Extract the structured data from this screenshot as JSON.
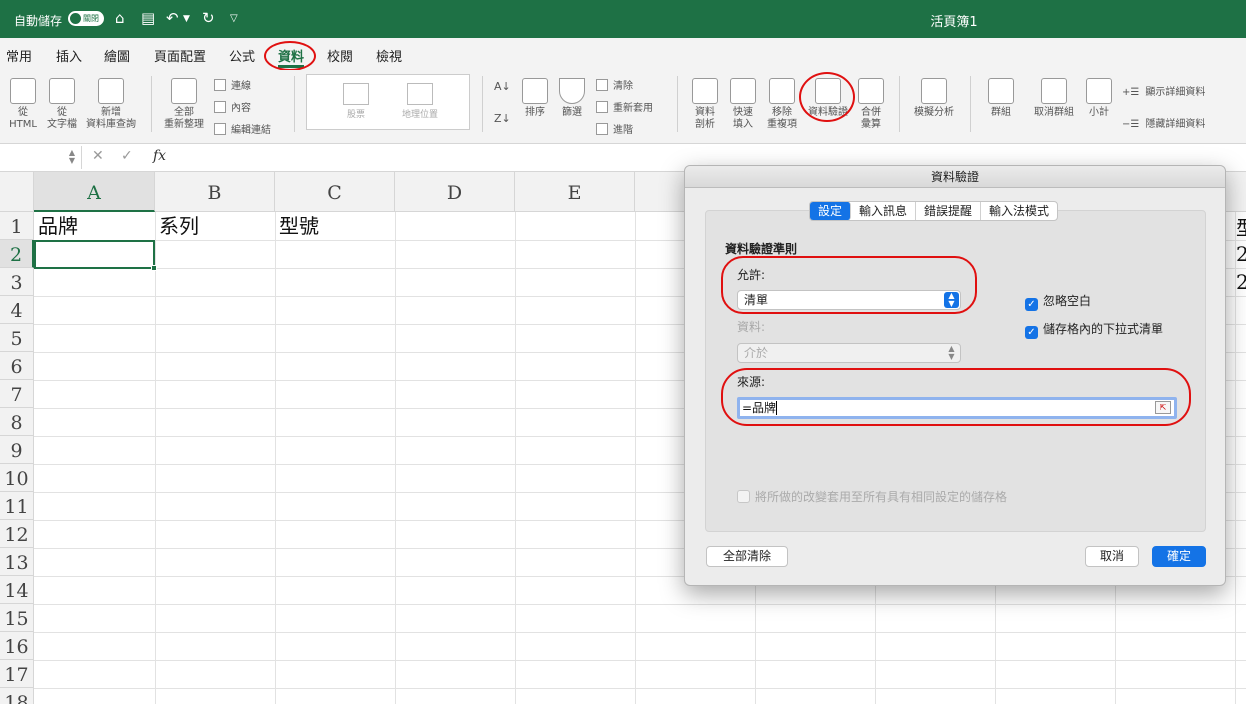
{
  "titlebar": {
    "autosave_label": "自動儲存",
    "autosave_state": "關閉",
    "doc_title": "活頁簿1",
    "icons": [
      "home-icon",
      "save-icon",
      "undo-icon",
      "redo-icon",
      "customize-icon"
    ]
  },
  "tabs": [
    "常用",
    "插入",
    "繪圖",
    "頁面配置",
    "公式",
    "資料",
    "校閱",
    "檢視"
  ],
  "active_tab": "資料",
  "ribbon": {
    "from_html": "從\nHTML",
    "from_text": "從\n文字檔",
    "new_query": "新增\n資料庫查詢",
    "refresh_all": "全部\n重新整理",
    "connections": "連線",
    "properties": "內容",
    "edit_links": "編輯連結",
    "stocks": "股票",
    "geography": "地理位置",
    "sort": "排序",
    "filter": "篩選",
    "clear": "清除",
    "reapply": "重新套用",
    "advanced": "進階",
    "text_to_columns": "資料\n剖析",
    "flash_fill": "快速\n填入",
    "remove_duplicates": "移除\n重複項",
    "data_validation": "資料驗證",
    "consolidate": "合併\n彙算",
    "what_if": "模擬分析",
    "group": "群組",
    "ungroup": "取消群組",
    "subtotal": "小計",
    "show_detail": "顯示詳細資料",
    "hide_detail": "隱藏詳細資料"
  },
  "formula_bar": {
    "name_box": "",
    "fx": "fx",
    "cancel_icon": "✕",
    "enter_icon": "✓",
    "formula": ""
  },
  "grid": {
    "columns": [
      "A",
      "B",
      "C",
      "D",
      "E"
    ],
    "rows": [
      "1",
      "2",
      "3",
      "4",
      "5",
      "6",
      "7",
      "8",
      "9",
      "10",
      "11",
      "12",
      "13",
      "14",
      "15",
      "16",
      "17",
      "18"
    ],
    "cells": {
      "A1": "品牌",
      "B1": "系列",
      "C1": "型號"
    },
    "partial_right": [
      "型",
      "2",
      "2"
    ]
  },
  "dialog": {
    "title": "資料驗證",
    "tabs": [
      "設定",
      "輸入訊息",
      "錯誤提醒",
      "輸入法模式"
    ],
    "active_tab": "設定",
    "criteria_heading": "資料驗證準則",
    "allow_label": "允許:",
    "allow_value": "清單",
    "data_label": "資料:",
    "data_value": "介於",
    "ignore_blank": "忽略空白",
    "in_cell_dropdown": "儲存格內的下拉式清單",
    "source_label": "來源:",
    "source_value": "=品牌",
    "apply_all": "將所做的改變套用至所有具有相同設定的儲存格",
    "clear_all": "全部清除",
    "cancel": "取消",
    "ok": "確定"
  },
  "colors": {
    "excel_green": "#1e7145",
    "accent_blue": "#1473e6",
    "annotation_red": "#e01010"
  }
}
